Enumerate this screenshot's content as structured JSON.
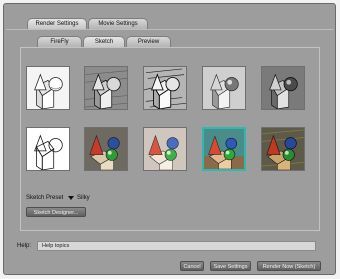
{
  "tabs_top": [
    {
      "label": "Render Settings",
      "active": true
    },
    {
      "label": "Movie Settings",
      "active": false
    }
  ],
  "tabs_sub": [
    {
      "label": "FireFly",
      "active": false
    },
    {
      "label": "Sketch",
      "active": true
    },
    {
      "label": "Preview",
      "active": false
    }
  ],
  "preset": {
    "label": "Sketch Preset",
    "value": "Silky"
  },
  "designer_button": "Sketch Designer...",
  "help": {
    "label": "Help:",
    "text": "Help topics"
  },
  "footer": {
    "cancel": "Cancel",
    "save": "Save Settings",
    "render": "Render Now (Sketch)"
  },
  "colors": {
    "selected_border": "#2fb8b0"
  },
  "thumbnails": [
    {
      "row": 1,
      "col": 1,
      "style": "pencil-clean",
      "selected": false
    },
    {
      "row": 1,
      "col": 2,
      "style": "dark-hatch",
      "selected": false
    },
    {
      "row": 1,
      "col": 3,
      "style": "scribble",
      "selected": false
    },
    {
      "row": 1,
      "col": 4,
      "style": "gray-shaded",
      "selected": false
    },
    {
      "row": 1,
      "col": 5,
      "style": "dark-shaded",
      "selected": false
    },
    {
      "row": 2,
      "col": 1,
      "style": "line-art",
      "selected": false
    },
    {
      "row": 2,
      "col": 2,
      "style": "color-dark",
      "selected": false
    },
    {
      "row": 2,
      "col": 3,
      "style": "color-light",
      "selected": false
    },
    {
      "row": 2,
      "col": 4,
      "style": "color-silky",
      "selected": true
    },
    {
      "row": 2,
      "col": 5,
      "style": "color-rough",
      "selected": false
    }
  ]
}
